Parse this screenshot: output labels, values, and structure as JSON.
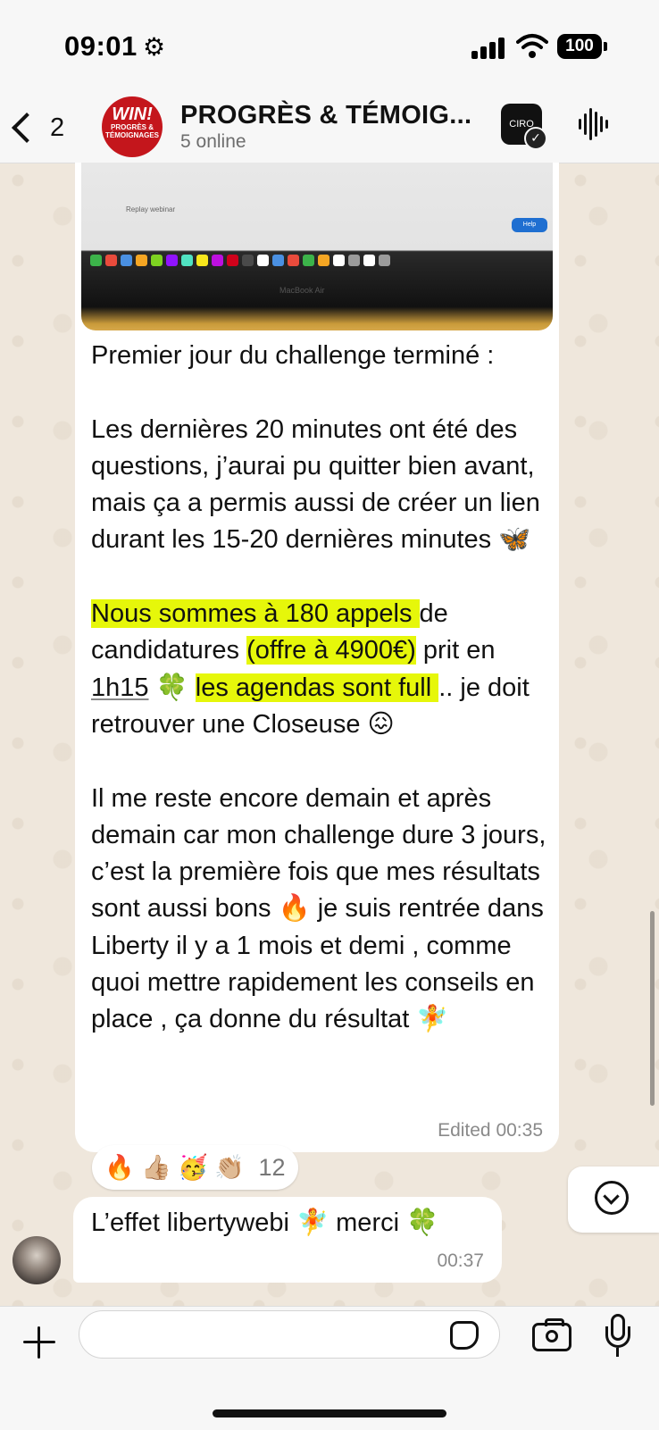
{
  "status_bar": {
    "time": "09:01",
    "battery": "100"
  },
  "header": {
    "back_count": "2",
    "group_name": "PROGRÈS & TÉMOIG...",
    "group_status": "5 online",
    "avatar_text_main": "WIN!",
    "avatar_text_sub": "PROGRÈS & TÉMOIGNAGES"
  },
  "messages": {
    "main": {
      "media": {
        "caption_snippet": "Replay webinar",
        "help_label": "Help",
        "brand": "MacBook Air"
      },
      "line1": "Premier jour du challenge terminé :",
      "para2": "Les dernières 20 minutes ont été des questions, j’aurai pu quitter bien avant, mais ça a permis aussi de créer un lien durant les 15-20 dernières minutes 🦋",
      "p3_hl1": "Nous sommes à 180 appels ",
      "p3_t1": "de candidatures ",
      "p3_hl2": "(offre à 4900€)",
      "p3_t2": " prit en ",
      "p3_ul": "1h15",
      "p3_t3": " 🍀 ",
      "p3_hl3": "les agendas sont full ",
      "p3_t4": ".. je doit retrouver une Closeuse 😖",
      "para4": "Il me reste encore demain et après demain car mon challenge dure 3 jours, c’est la première fois que mes résultats sont aussi bons 🔥 je suis rentrée dans Liberty il y a 1 mois et demi , comme quoi mettre rapidement les conseils en place , ça donne du résultat 🧚",
      "meta": "Edited 00:35",
      "reactions": "🔥 👍🏼 🥳 👏🏼",
      "reaction_count": "12"
    },
    "reply": {
      "text": "L’effet libertywebi 🧚 merci 🍀",
      "time": "00:37"
    }
  },
  "input": {
    "placeholder": ""
  },
  "colors": {
    "highlight": "#e6f70a",
    "wallpaper": "#efe7dc",
    "avatar_red": "#c4161c"
  },
  "icons": [
    "gear-icon",
    "signal-icon",
    "wifi-icon",
    "back-chevron-icon",
    "voice-chat-icon",
    "scroll-down-icon",
    "plus-icon",
    "sticker-icon",
    "camera-icon",
    "mic-icon"
  ]
}
